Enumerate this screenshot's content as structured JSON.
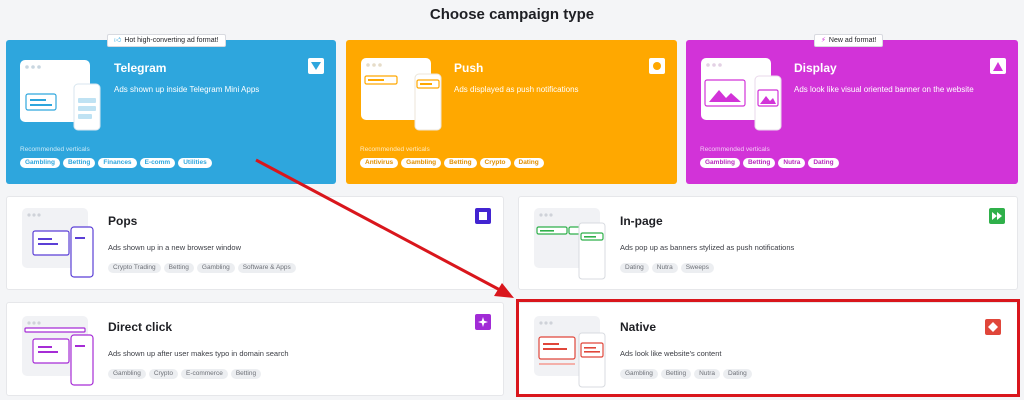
{
  "page": {
    "title": "Choose campaign type"
  },
  "colors": {
    "telegram": "#2ea6dd",
    "push": "#ffa800",
    "display": "#d233d8",
    "annotation": "#d9161c"
  },
  "recommended_label": "Recommended verticals",
  "cards": {
    "telegram": {
      "name": "Telegram",
      "description": "Ads shown up inside Telegram Mini Apps",
      "badge": "Hot high-converting ad format!",
      "badge_icon": "thumbs-up-icon",
      "corner_icon": "triangle-down-icon",
      "tags": [
        "Gambling",
        "Betting",
        "Finances",
        "E-comm",
        "Utilities"
      ]
    },
    "push": {
      "name": "Push",
      "description": "Ads displayed as push notifications",
      "corner_icon": "circle-icon",
      "tags": [
        "Antivirus",
        "Gambling",
        "Betting",
        "Crypto",
        "Dating"
      ]
    },
    "display": {
      "name": "Display",
      "description": "Ads look like visual oriented banner on the website",
      "badge": "New ad format!",
      "badge_icon": "bolt-icon",
      "corner_icon": "triangle-up-icon",
      "tags": [
        "Gambling",
        "Betting",
        "Nutra",
        "Dating"
      ]
    },
    "pops": {
      "name": "Pops",
      "description": "Ads shown up in a new browser window",
      "corner_icon": "square-icon",
      "tags": [
        "Crypto Trading",
        "Betting",
        "Gambling",
        "Software & Apps"
      ]
    },
    "inpage": {
      "name": "In-page",
      "description": "Ads pop up as banners stylized as push notifications",
      "corner_icon": "fast-forward-icon",
      "tags": [
        "Dating",
        "Nutra",
        "Sweeps"
      ]
    },
    "directclick": {
      "name": "Direct click",
      "description": "Ads shown up after user makes typo in domain search",
      "corner_icon": "sparkle-icon",
      "tags": [
        "Gambling",
        "Crypto",
        "E-commerce",
        "Betting"
      ]
    },
    "native": {
      "name": "Native",
      "description": "Ads look like website's content",
      "corner_icon": "diamond-icon",
      "tags": [
        "Gambling",
        "Betting",
        "Nutra",
        "Dating"
      ]
    }
  }
}
